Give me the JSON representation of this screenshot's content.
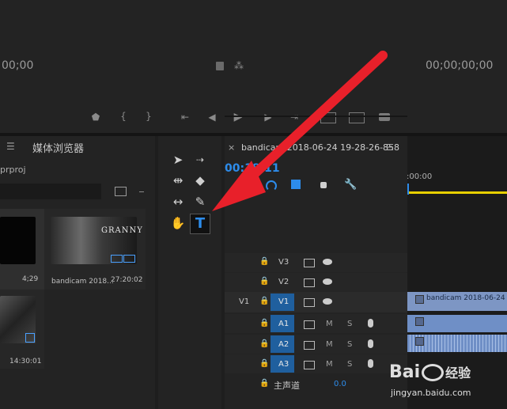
{
  "monitor": {
    "source_timecode": "00;00",
    "program_timecode": "00;00;00;00"
  },
  "project": {
    "tab_label": "媒体浏览器",
    "file_suffix": "prproj",
    "items": [
      {
        "name": "",
        "duration": "4;29"
      },
      {
        "name": "bandicam 2018...",
        "duration": "27:20:02",
        "thumb_title": "GRANNY"
      },
      {
        "name": "",
        "duration": "14:30:01"
      }
    ]
  },
  "timeline": {
    "tab_title": "bandicam 2018-06-24 19-28-26-858",
    "timecode": "00:18:11",
    "ruler_start": ":00:00",
    "tracks": [
      {
        "name": "V3"
      },
      {
        "name": "V2"
      },
      {
        "name": "V1",
        "source": "V1"
      },
      {
        "name": "A1",
        "m": "M",
        "s": "S"
      },
      {
        "name": "A2",
        "m": "M",
        "s": "S"
      },
      {
        "name": "A3",
        "m": "M",
        "s": "S"
      }
    ],
    "master": {
      "label": "主声道",
      "value": "0.0"
    },
    "clip_label": "bandicam 2018-06-24 19-"
  },
  "watermark": {
    "brand": "Bai",
    "brand_suffix": "经验",
    "url": "jingyan.baidu.com"
  },
  "colors": {
    "accent_blue": "#2d8ceb",
    "ruler_yellow": "#e8d000",
    "arrow_red": "#e8202a",
    "track_active": "#1f5f9e"
  }
}
